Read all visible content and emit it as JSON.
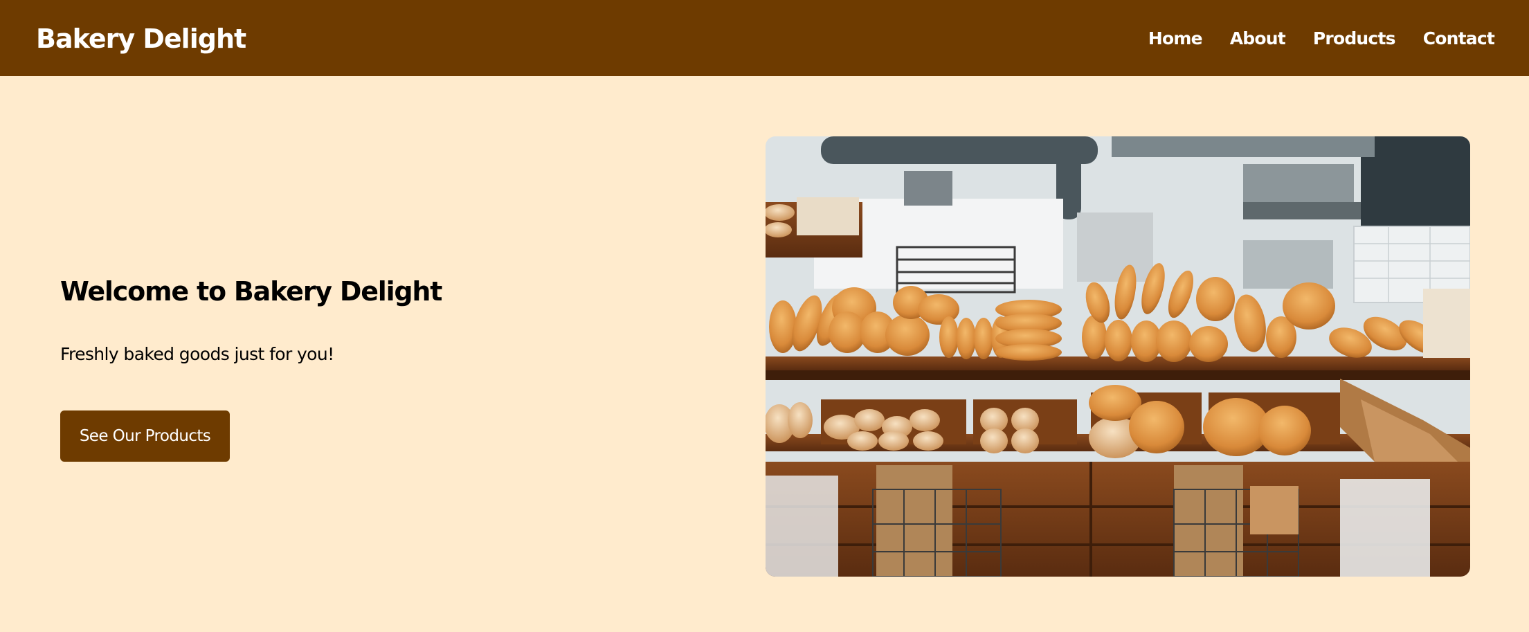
{
  "header": {
    "logo": "Bakery Delight",
    "nav": [
      "Home",
      "About",
      "Products",
      "Contact"
    ]
  },
  "hero": {
    "title": "Welcome to Bakery Delight",
    "subtitle": "Freshly baked goods just for you!",
    "cta_label": "See Our Products"
  },
  "colors": {
    "header_bg": "#6E3B00",
    "page_bg": "#FFEBCD",
    "button_bg": "#6E3B00",
    "text_on_dark": "#FFFFFF"
  }
}
